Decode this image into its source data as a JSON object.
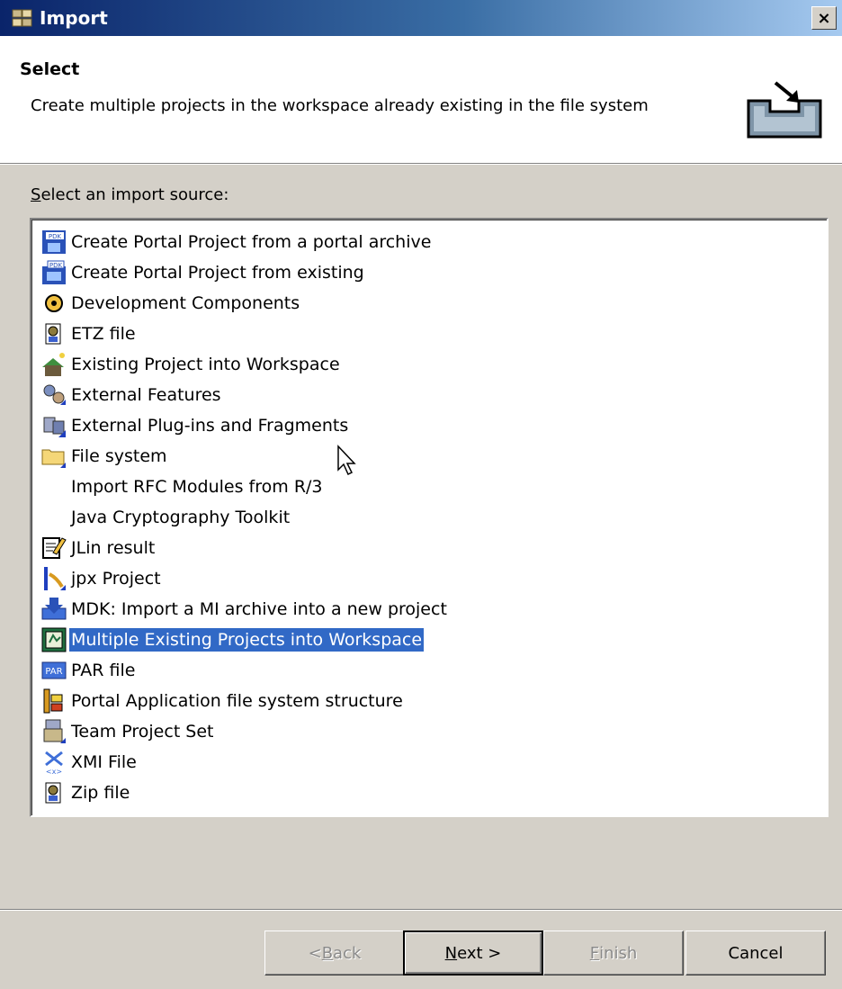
{
  "window": {
    "title": "Import",
    "close_label": "×"
  },
  "header": {
    "title": "Select",
    "description": "Create multiple projects in the workspace already existing in the file system"
  },
  "source": {
    "label_first": "S",
    "label_rest": "elect an import source:",
    "items": [
      {
        "label": "Create Portal Project from a portal archive",
        "icon": "pdk-archive-icon"
      },
      {
        "label": "Create Portal Project from existing",
        "icon": "pdk-existing-icon"
      },
      {
        "label": "Development Components",
        "icon": "component-icon"
      },
      {
        "label": "ETZ file",
        "icon": "etz-file-icon"
      },
      {
        "label": "Existing Project into Workspace",
        "icon": "existing-project-icon"
      },
      {
        "label": "External Features",
        "icon": "external-features-icon"
      },
      {
        "label": "External Plug-ins and Fragments",
        "icon": "plugin-icon"
      },
      {
        "label": "File system",
        "icon": "folder-icon"
      },
      {
        "label": "Import RFC Modules from R/3",
        "icon": ""
      },
      {
        "label": "Java Cryptography Toolkit",
        "icon": ""
      },
      {
        "label": "JLin result",
        "icon": "jlin-icon"
      },
      {
        "label": "jpx Project",
        "icon": "jpx-icon"
      },
      {
        "label": "MDK: Import a MI archive into a new project",
        "icon": "mdk-icon"
      },
      {
        "label": "Multiple Existing Projects into Workspace",
        "icon": "multiple-projects-icon",
        "selected": true
      },
      {
        "label": "PAR file",
        "icon": "par-file-icon"
      },
      {
        "label": "Portal Application file system structure",
        "icon": "portal-app-icon"
      },
      {
        "label": "Team Project Set",
        "icon": "team-project-icon"
      },
      {
        "label": "XMI File",
        "icon": "xmi-file-icon"
      },
      {
        "label": "Zip file",
        "icon": "zip-file-icon"
      }
    ]
  },
  "buttons": {
    "back_prefix": "< ",
    "back_mn": "B",
    "back_rest": "ack",
    "next_mn": "N",
    "next_rest": "ext >",
    "finish_mn": "F",
    "finish_rest": "inish",
    "cancel": "Cancel"
  },
  "colors": {
    "selection": "#3169c6",
    "titlebar_start": "#0a246a",
    "titlebar_end": "#a6caf0"
  }
}
